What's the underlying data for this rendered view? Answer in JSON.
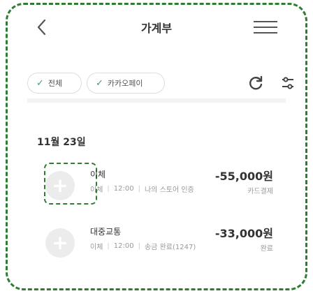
{
  "header": {
    "title": "가계부"
  },
  "filters": {
    "chips": [
      {
        "label": "전체"
      },
      {
        "label": "카카오페이"
      }
    ]
  },
  "list": {
    "date_label": "11월 23일",
    "transactions": [
      {
        "name": "이체",
        "type": "이체",
        "time": "12:00",
        "memo": "나의 스토어 인증",
        "amount": "-55,000원",
        "status": "카드결제"
      },
      {
        "name": "대중교통",
        "type": "이체",
        "time": "12:00",
        "memo": "송금 완료(1247)",
        "amount": "-33,000원",
        "status": "완료"
      }
    ]
  },
  "colors": {
    "accent": "#3b9d6a",
    "frame": "#2e7d32",
    "text": "#333333",
    "muted": "#999999"
  },
  "icons": [
    "chevron-left-icon",
    "menu-icon",
    "check-icon",
    "refresh-icon",
    "settings-icon",
    "plus-icon"
  ]
}
